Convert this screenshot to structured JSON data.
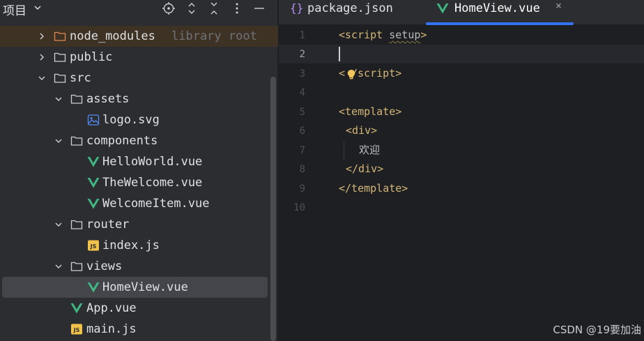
{
  "project_panel": {
    "title": "项目",
    "tree": [
      {
        "label": "node_modules",
        "hint": "library root",
        "type": "folder",
        "icon": "folder-orange-icon",
        "expanded": false
      },
      {
        "label": "public",
        "type": "folder",
        "icon": "folder-icon",
        "expanded": false
      },
      {
        "label": "src",
        "type": "folder",
        "icon": "folder-icon",
        "expanded": true
      },
      {
        "label": "assets",
        "type": "folder",
        "icon": "folder-icon",
        "expanded": true
      },
      {
        "label": "logo.svg",
        "type": "file",
        "icon": "image-file-icon"
      },
      {
        "label": "components",
        "type": "folder",
        "icon": "folder-icon",
        "expanded": true
      },
      {
        "label": "HelloWorld.vue",
        "type": "file",
        "icon": "vue-icon"
      },
      {
        "label": "TheWelcome.vue",
        "type": "file",
        "icon": "vue-icon"
      },
      {
        "label": "WelcomeItem.vue",
        "type": "file",
        "icon": "vue-icon"
      },
      {
        "label": "router",
        "type": "folder",
        "icon": "folder-icon",
        "expanded": true
      },
      {
        "label": "index.js",
        "type": "file",
        "icon": "js-icon",
        "badge": "JS"
      },
      {
        "label": "views",
        "type": "folder",
        "icon": "folder-icon",
        "expanded": true
      },
      {
        "label": "HomeView.vue",
        "type": "file",
        "icon": "vue-icon",
        "selected": true
      },
      {
        "label": "App.vue",
        "type": "file",
        "icon": "vue-icon"
      },
      {
        "label": "main.js",
        "type": "file",
        "icon": "js-icon",
        "badge": "JS"
      }
    ]
  },
  "editor": {
    "tabs": [
      {
        "label": "package.json",
        "icon": "json-braces-icon",
        "glyph": "{}",
        "active": false
      },
      {
        "label": "HomeView.vue",
        "icon": "vue-icon",
        "active": true,
        "close": "×"
      }
    ],
    "line_numbers": [
      "1",
      "2",
      "3",
      "4",
      "5",
      "6",
      "7",
      "8",
      "9",
      "10"
    ],
    "active_line": 2,
    "code": {
      "l1_tag_open": "<script",
      "l1_attr": "setup",
      "l1_tag_close": ">",
      "l3_a": "<",
      "l3_b": "/script>",
      "l5": "<template>",
      "l6": "<div>",
      "l7": "欢迎",
      "l8": "</div>",
      "l9": "</template>"
    }
  },
  "watermark": "CSDN @19要加油",
  "colors": {
    "panel_bg": "#2b2d30",
    "editor_bg": "#1e1f22",
    "selection": "#43454a",
    "tab_accent": "#3574f0",
    "vue_green": "#41b883",
    "tag_color": "#d5b778"
  }
}
